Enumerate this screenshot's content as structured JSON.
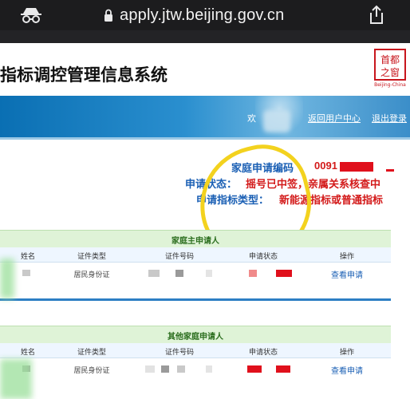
{
  "browser": {
    "url": "apply.jtw.beijing.gov.cn"
  },
  "header": {
    "title": "指标调控管理信息系统",
    "logo_text": "首都之窗",
    "logo_sub": "Beijing-China"
  },
  "banner": {
    "welcome": "欢",
    "links": [
      "返回用户中心",
      "退出登录"
    ]
  },
  "info": {
    "code_label": "家庭申请编码",
    "code_value": "0091",
    "status_label": "申请状态：",
    "status_value": "摇号已中签，亲属关系核查中",
    "type_label": "申请指标类型：",
    "type_value": "新能源指标或普通指标"
  },
  "tables": [
    {
      "title": "家庭主申请人",
      "columns": [
        "姓名",
        "证件类型",
        "证件号码",
        "申请状态",
        "操作"
      ],
      "row": {
        "id_type": "居民身份证",
        "action": "查看申请"
      }
    },
    {
      "title": "其他家庭申请人",
      "columns": [
        "姓名",
        "证件类型",
        "证件号码",
        "申请状态",
        "操作"
      ],
      "row": {
        "id_type": "居民身份证",
        "action": "查看申请"
      }
    }
  ],
  "colors": {
    "accent_blue": "#1a5fb4",
    "alert_red": "#d31a1a",
    "highlight": "#f3d21e",
    "table_green": "#dff3d7"
  }
}
